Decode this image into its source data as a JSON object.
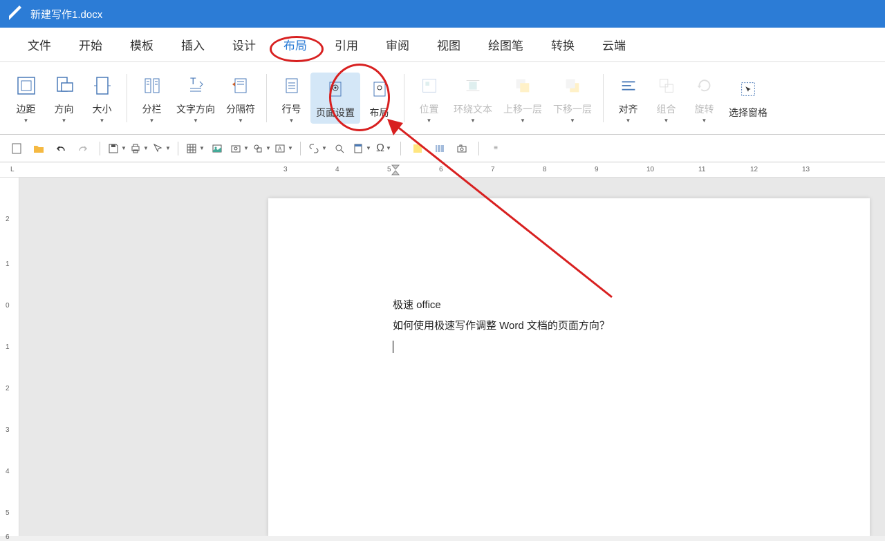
{
  "titlebar": {
    "filename": "新建写作1.docx"
  },
  "menu": {
    "tabs": [
      "文件",
      "开始",
      "模板",
      "插入",
      "设计",
      "布局",
      "引用",
      "审阅",
      "视图",
      "绘图笔",
      "转换",
      "云端"
    ],
    "active_index": 5
  },
  "ribbon": {
    "buttons": [
      {
        "label": "边距",
        "icon": "margins",
        "dropdown": true
      },
      {
        "label": "方向",
        "icon": "orientation",
        "dropdown": true
      },
      {
        "label": "大小",
        "icon": "size",
        "dropdown": true
      },
      {
        "label": "分栏",
        "icon": "columns",
        "dropdown": true
      },
      {
        "label": "文字方向",
        "icon": "text-direction",
        "dropdown": true
      },
      {
        "label": "分隔符",
        "icon": "breaks",
        "dropdown": true
      },
      {
        "label": "行号",
        "icon": "line-numbers",
        "dropdown": true
      },
      {
        "label": "页面设置",
        "icon": "page-setup",
        "dropdown": false,
        "highlighted": true
      },
      {
        "label": "布局",
        "icon": "layout",
        "dropdown": false
      },
      {
        "label": "位置",
        "icon": "position",
        "dropdown": true,
        "disabled": true
      },
      {
        "label": "环绕文本",
        "icon": "wrap-text",
        "dropdown": true,
        "disabled": true
      },
      {
        "label": "上移一层",
        "icon": "bring-forward",
        "dropdown": true,
        "disabled": true
      },
      {
        "label": "下移一层",
        "icon": "send-backward",
        "dropdown": true,
        "disabled": true
      },
      {
        "label": "对齐",
        "icon": "align",
        "dropdown": true
      },
      {
        "label": "组合",
        "icon": "group",
        "dropdown": true,
        "disabled": true
      },
      {
        "label": "旋转",
        "icon": "rotate",
        "dropdown": true,
        "disabled": true
      },
      {
        "label": "选择窗格",
        "icon": "selection-pane",
        "dropdown": false
      }
    ]
  },
  "ruler_h": {
    "marks": [
      3,
      4,
      5,
      6,
      7,
      8,
      9,
      10,
      11,
      12,
      13
    ],
    "indicator": "L"
  },
  "ruler_v": {
    "marks": [
      2,
      1,
      0,
      1,
      2,
      3,
      4,
      5,
      6
    ]
  },
  "document": {
    "line1": "极速 office",
    "line2": "如何使用极速写作调整 Word 文档的页面方向？"
  }
}
